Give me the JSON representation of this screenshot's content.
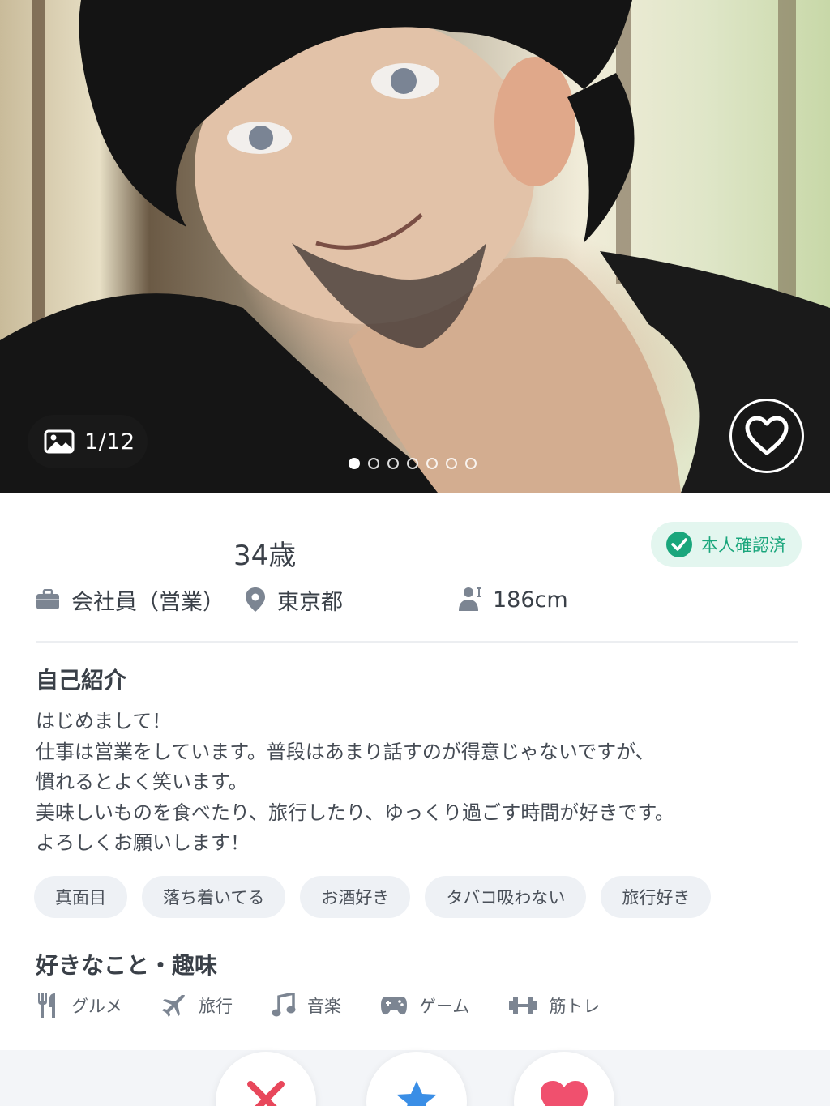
{
  "photo": {
    "counter": "1/12",
    "page_current": 1,
    "page_dots_count": 7
  },
  "profile": {
    "age": "34歳",
    "verified_label": "本人確認済",
    "job": "会社員（営業）",
    "location": "東京都",
    "height": "186cm"
  },
  "intro": {
    "title": "自己紹介",
    "lines": [
      "はじめまして！",
      "仕事は営業をしています。普段はあまり話すのが得意じゃないですが、",
      "慣れるとよく笑います。",
      "美味しいものを食べたり、旅行したり、ゆっくり過ごす時間が好きです。",
      "よろしくお願いします！"
    ]
  },
  "tags": [
    "真面目",
    "落ち着いてる",
    "お酒好き",
    "タバコ吸わない",
    "旅行好き"
  ],
  "hobbies": {
    "title": "好きなこと・趣味",
    "items": [
      {
        "label": "グルメ",
        "icon": "fork-knife-icon"
      },
      {
        "label": "旅行",
        "icon": "airplane-icon"
      },
      {
        "label": "音楽",
        "icon": "music-note-icon"
      },
      {
        "label": "ゲーム",
        "icon": "gamepad-icon"
      },
      {
        "label": "筋トレ",
        "icon": "dumbbell-icon"
      }
    ]
  },
  "colors": {
    "verified_green": "#1aa67c",
    "verified_bg": "#e3f6ef",
    "skip_red": "#e8475b",
    "super_blue": "#3a8ee6",
    "like_pink": "#f0506e"
  }
}
